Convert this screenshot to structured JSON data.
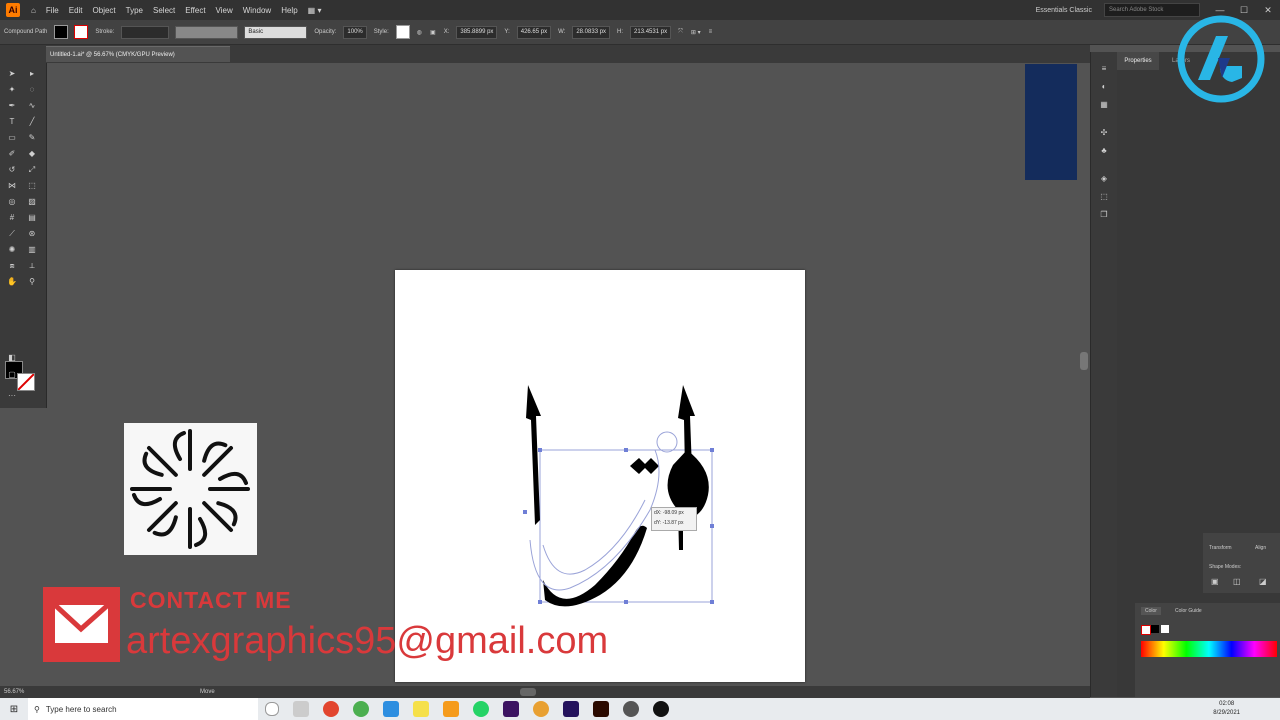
{
  "menubar": {
    "items": [
      "File",
      "Edit",
      "Object",
      "Type",
      "Select",
      "Effect",
      "View",
      "Window",
      "Help"
    ],
    "workspace": "Essentials Classic",
    "search_placeholder": "Search Adobe Stock"
  },
  "control_bar": {
    "object_type": "Compound Path",
    "stroke_label": "Stroke:",
    "brush_label": "Basic",
    "opacity_label": "Opacity:",
    "opacity_value": "100%",
    "style_label": "Style:",
    "x_value": "385.8899 px",
    "y_value": "426.65 px",
    "w_value": "28.0833 px",
    "h_value": "213.4531 px"
  },
  "document_tab": "Untitled-1.ai* @ 56.67% (CMYK/GPU Preview)",
  "panels": {
    "properties_tab": "Properties",
    "layers_tab": "Layers",
    "transform_tab": "Transform",
    "align_tab": "Align",
    "shape_modes_label": "Shape Modes:",
    "color_tab": "Color",
    "color_guide_tab": "Color Guide"
  },
  "tooltip": {
    "dx": "dX: -98.09 px",
    "dy": "dY: -13.87 px"
  },
  "status": {
    "zoom": "56.67%",
    "mode": "Move"
  },
  "taskbar": {
    "search_placeholder": "Type here to search",
    "time": "02:08",
    "date": "8/29/2021"
  },
  "overlay": {
    "contact_title": "CONTACT ME",
    "email": "artexgraphics95@gmail.com"
  },
  "colors": {
    "accent_red": "#d9393b",
    "app_bg": "#535353",
    "navy_shape": "#142c5c",
    "logo_cyan": "#29b6e6"
  }
}
